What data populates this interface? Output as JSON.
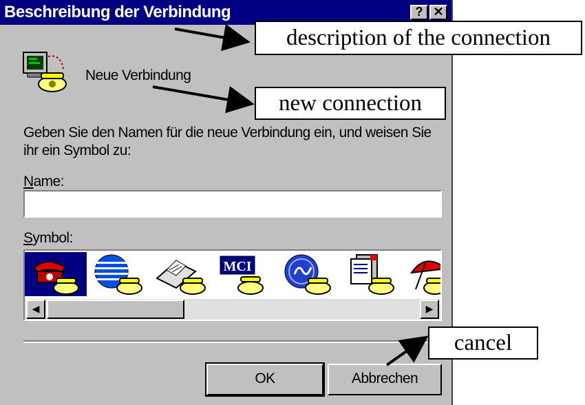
{
  "window": {
    "title": "Beschreibung der Verbindung",
    "help_glyph": "?",
    "close_glyph": "✕"
  },
  "connection": {
    "icon": "modem-computer-icon",
    "name": "Neue Verbindung"
  },
  "instruction": "Geben Sie den Namen für die neue Verbindung ein, und weisen Sie ihr ein Symbol zu:",
  "name_field": {
    "label_accel": "N",
    "label_rest": "ame:",
    "value": ""
  },
  "symbol": {
    "label_accel": "S",
    "label_rest": "ymbol:",
    "icons": [
      "red-telephone-icon",
      "globe-telephone-icon",
      "fax-telephone-icon",
      "mci-telephone-icon",
      "ge-telephone-icon",
      "documents-telephone-icon",
      "umbrella-telephone-icon"
    ],
    "selected_index": 0,
    "mci_text": "MCI"
  },
  "buttons": {
    "ok": "OK",
    "cancel": "Abbrechen"
  },
  "annotations": {
    "title": "description of the connection",
    "name": "new connection",
    "cancel": "cancel"
  },
  "colors": {
    "titlebar": "#000080",
    "face": "#c0c0c0",
    "selection": "#000080"
  }
}
